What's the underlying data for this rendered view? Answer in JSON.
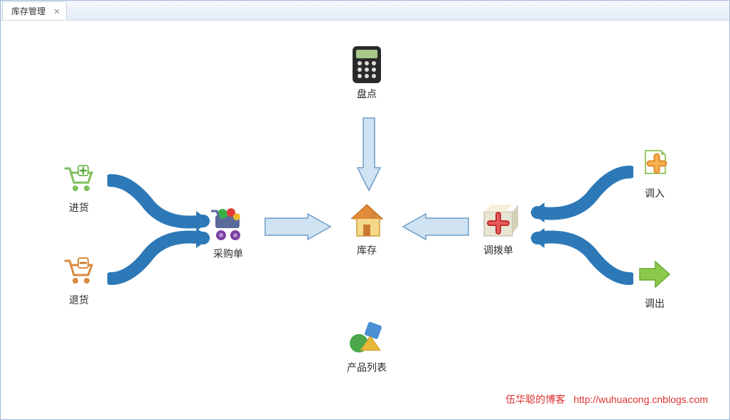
{
  "tab": {
    "title": "库存管理",
    "close": "✕"
  },
  "nodes": {
    "stockin": "进货",
    "return": "退货",
    "purchase": "采购单",
    "stocktake": "盘点",
    "inventory": "库存",
    "transfer": "调拨单",
    "transferin": "调入",
    "transferout": "调出",
    "products": "产品列表"
  },
  "credit": {
    "text": "伍华聪的博客",
    "url_label": "http://wuhuacong.cnblogs.com"
  },
  "colors": {
    "arrow_blue": "#8fb6d8",
    "arrow_border": "#6d9bc5",
    "conn_blue": "#2d79b8"
  }
}
